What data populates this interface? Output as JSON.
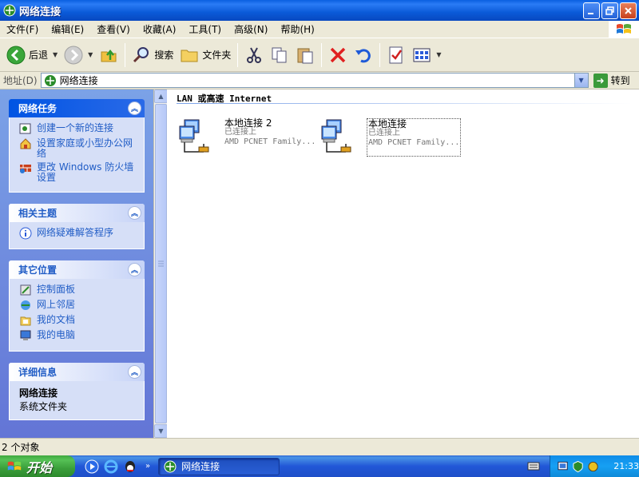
{
  "window": {
    "title": "网络连接"
  },
  "menu": [
    "文件(F)",
    "编辑(E)",
    "查看(V)",
    "收藏(A)",
    "工具(T)",
    "高级(N)",
    "帮助(H)"
  ],
  "toolbar": {
    "back": "后退",
    "search": "搜索",
    "folders": "文件夹"
  },
  "address": {
    "label": "地址(D)",
    "value": "网络连接",
    "go": "转到"
  },
  "panels": {
    "network_tasks": {
      "title": "网络任务",
      "items": [
        "创建一个新的连接",
        "设置家庭或小型办公网络",
        "更改 Windows 防火墙设置"
      ]
    },
    "related_topics": {
      "title": "相关主题",
      "items": [
        "网络疑难解答程序"
      ]
    },
    "other_places": {
      "title": "其它位置",
      "items": [
        "控制面板",
        "网上邻居",
        "我的文档",
        "我的电脑"
      ]
    },
    "details": {
      "title": "详细信息",
      "name": "网络连接",
      "type": "系统文件夹"
    }
  },
  "content": {
    "group": "LAN 或高速 Internet",
    "connections": [
      {
        "name": "本地连接 2",
        "status": "已连接上",
        "device": "AMD PCNET Family..."
      },
      {
        "name": "本地连接",
        "status": "已连接上",
        "device": "AMD PCNET Family..."
      }
    ]
  },
  "status": {
    "text": "2 个对象"
  },
  "taskbar": {
    "start": "开始",
    "task": "网络连接",
    "clock": "21:33"
  },
  "colors": {
    "titlebar": "#0a5fe0",
    "taskpane": "#7ba2e7",
    "start": "#3ea83e",
    "tray": "#0f8ce8"
  }
}
